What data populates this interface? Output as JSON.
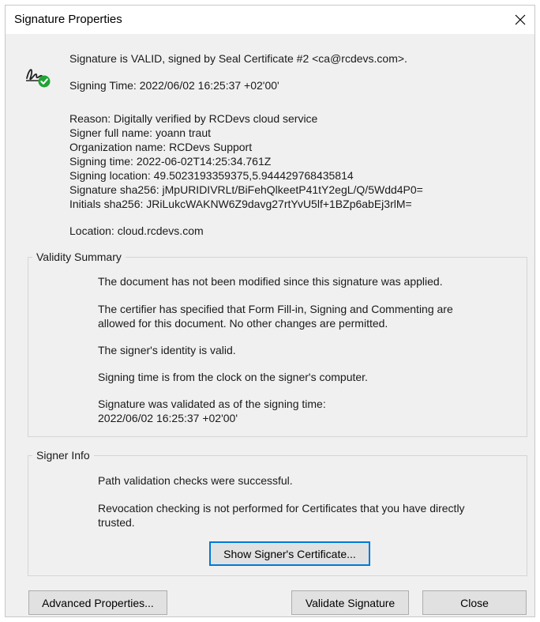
{
  "window": {
    "title": "Signature Properties"
  },
  "header": {
    "status": "Signature is VALID, signed by Seal Certificate #2 <ca@rcdevs.com>.",
    "signing_time": "Signing Time:  2022/06/02 16:25:37 +02'00'"
  },
  "details": [
    "Reason:  Digitally verified by RCDevs cloud service",
    "Signer full name: yoann traut",
    "Organization name: RCDevs Support",
    "Signing time: 2022-06-02T14:25:34.761Z",
    "Signing location: 49.5023193359375,5.944429768435814",
    "Signature sha256: jMpURIDIVRLt/BiFehQlkeetP41tY2egL/Q/5Wdd4P0=",
    "Initials sha256: JRiLukcWAKNW6Z9davg27rtYvU5lf+1BZp6abEj3rlM="
  ],
  "location": "Location:  cloud.rcdevs.com",
  "validity": {
    "title": "Validity Summary",
    "lines": [
      "The document has not been modified since this signature was applied.",
      "The certifier has specified that Form Fill-in, Signing and Commenting are",
      "allowed for this document. No other changes are permitted.",
      "The signer's identity is valid.",
      "Signing time is from the clock on the signer's computer.",
      "Signature was validated as of the signing time:",
      "2022/06/02 16:25:37 +02'00'"
    ]
  },
  "signer_info": {
    "title": "Signer Info",
    "lines": [
      "Path validation checks were successful.",
      "Revocation checking is not performed for Certificates that you have directly",
      "trusted."
    ],
    "show_cert_label": "Show Signer's Certificate..."
  },
  "buttons": {
    "advanced": "Advanced Properties...",
    "validate": "Validate Signature",
    "close": "Close"
  },
  "colors": {
    "accent": "#0078d7",
    "valid_badge": "#21a336"
  }
}
